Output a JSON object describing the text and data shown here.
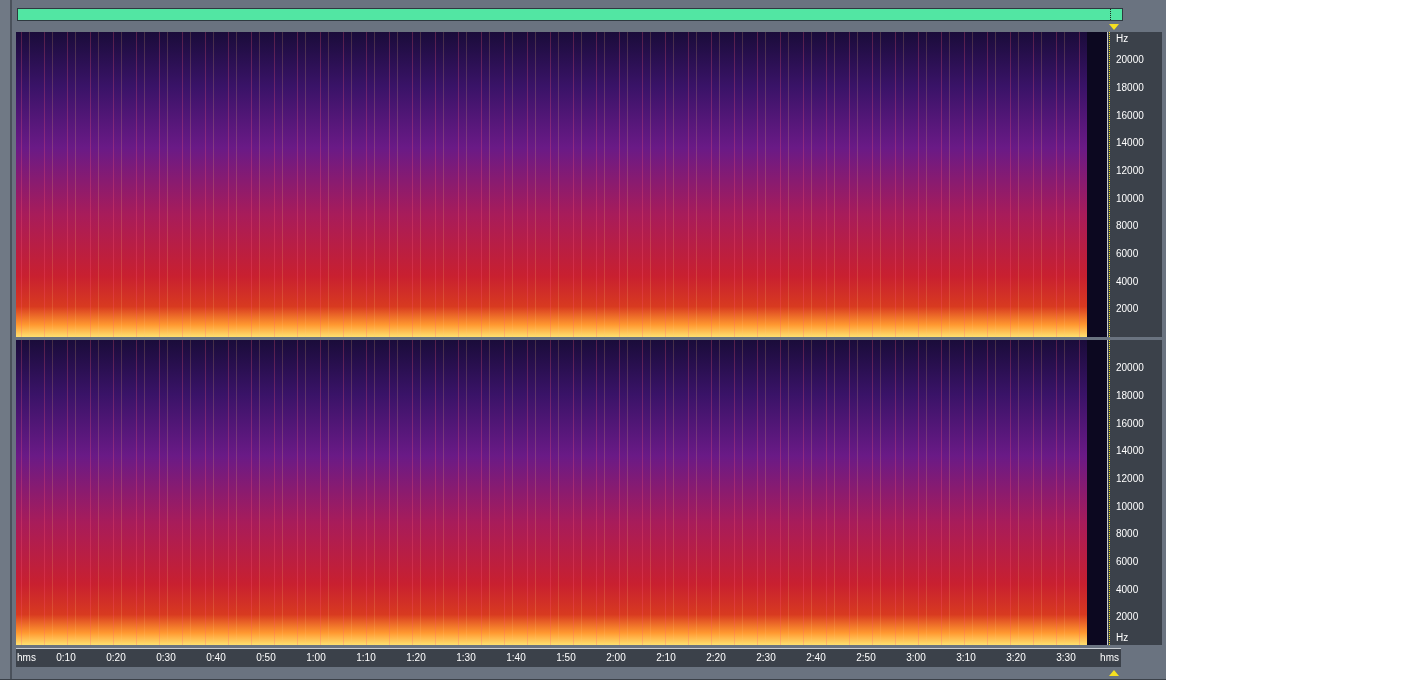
{
  "channels": [
    {
      "frequency_axis": [
        {
          "kind": "unit",
          "text": "Hz"
        },
        {
          "kind": "tick",
          "text": "20000"
        },
        {
          "kind": "tick",
          "text": "18000"
        },
        {
          "kind": "tick",
          "text": "16000"
        },
        {
          "kind": "tick",
          "text": "14000"
        },
        {
          "kind": "tick",
          "text": "12000"
        },
        {
          "kind": "tick",
          "text": "10000"
        },
        {
          "kind": "tick",
          "text": "8000"
        },
        {
          "kind": "tick",
          "text": "6000"
        },
        {
          "kind": "tick",
          "text": "4000"
        },
        {
          "kind": "tick",
          "text": "2000"
        }
      ]
    },
    {
      "frequency_axis": [
        {
          "kind": "tick",
          "text": "20000"
        },
        {
          "kind": "tick",
          "text": "18000"
        },
        {
          "kind": "tick",
          "text": "16000"
        },
        {
          "kind": "tick",
          "text": "14000"
        },
        {
          "kind": "tick",
          "text": "12000"
        },
        {
          "kind": "tick",
          "text": "10000"
        },
        {
          "kind": "tick",
          "text": "8000"
        },
        {
          "kind": "tick",
          "text": "6000"
        },
        {
          "kind": "tick",
          "text": "4000"
        },
        {
          "kind": "tick",
          "text": "2000"
        },
        {
          "kind": "unit",
          "text": "Hz"
        }
      ]
    }
  ],
  "time_axis": {
    "unit_left": "hms",
    "unit_right": "hms",
    "ticks": [
      "0:10",
      "0:20",
      "0:30",
      "0:40",
      "0:50",
      "1:00",
      "1:10",
      "1:20",
      "1:30",
      "1:40",
      "1:50",
      "2:00",
      "2:10",
      "2:20",
      "2:30",
      "2:40",
      "2:50",
      "3:00",
      "3:10",
      "3:20",
      "3:30"
    ]
  }
}
